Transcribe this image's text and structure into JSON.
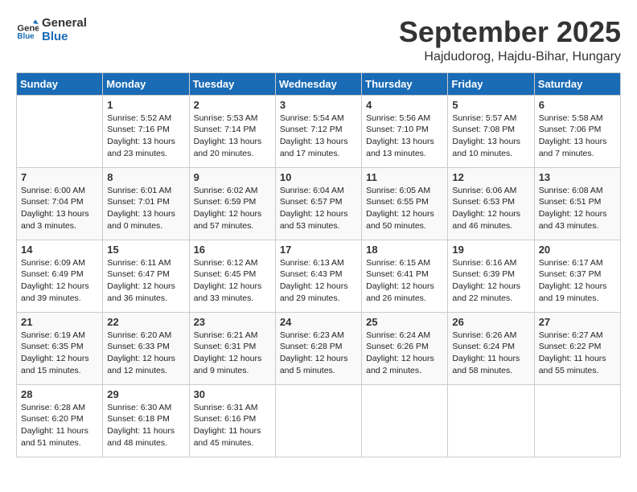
{
  "header": {
    "logo_line1": "General",
    "logo_line2": "Blue",
    "month_title": "September 2025",
    "location": "Hajdudorog, Hajdu-Bihar, Hungary"
  },
  "days_of_week": [
    "Sunday",
    "Monday",
    "Tuesday",
    "Wednesday",
    "Thursday",
    "Friday",
    "Saturday"
  ],
  "weeks": [
    [
      {
        "day": "",
        "info": ""
      },
      {
        "day": "1",
        "info": "Sunrise: 5:52 AM\nSunset: 7:16 PM\nDaylight: 13 hours\nand 23 minutes."
      },
      {
        "day": "2",
        "info": "Sunrise: 5:53 AM\nSunset: 7:14 PM\nDaylight: 13 hours\nand 20 minutes."
      },
      {
        "day": "3",
        "info": "Sunrise: 5:54 AM\nSunset: 7:12 PM\nDaylight: 13 hours\nand 17 minutes."
      },
      {
        "day": "4",
        "info": "Sunrise: 5:56 AM\nSunset: 7:10 PM\nDaylight: 13 hours\nand 13 minutes."
      },
      {
        "day": "5",
        "info": "Sunrise: 5:57 AM\nSunset: 7:08 PM\nDaylight: 13 hours\nand 10 minutes."
      },
      {
        "day": "6",
        "info": "Sunrise: 5:58 AM\nSunset: 7:06 PM\nDaylight: 13 hours\nand 7 minutes."
      }
    ],
    [
      {
        "day": "7",
        "info": "Sunrise: 6:00 AM\nSunset: 7:04 PM\nDaylight: 13 hours\nand 3 minutes."
      },
      {
        "day": "8",
        "info": "Sunrise: 6:01 AM\nSunset: 7:01 PM\nDaylight: 13 hours\nand 0 minutes."
      },
      {
        "day": "9",
        "info": "Sunrise: 6:02 AM\nSunset: 6:59 PM\nDaylight: 12 hours\nand 57 minutes."
      },
      {
        "day": "10",
        "info": "Sunrise: 6:04 AM\nSunset: 6:57 PM\nDaylight: 12 hours\nand 53 minutes."
      },
      {
        "day": "11",
        "info": "Sunrise: 6:05 AM\nSunset: 6:55 PM\nDaylight: 12 hours\nand 50 minutes."
      },
      {
        "day": "12",
        "info": "Sunrise: 6:06 AM\nSunset: 6:53 PM\nDaylight: 12 hours\nand 46 minutes."
      },
      {
        "day": "13",
        "info": "Sunrise: 6:08 AM\nSunset: 6:51 PM\nDaylight: 12 hours\nand 43 minutes."
      }
    ],
    [
      {
        "day": "14",
        "info": "Sunrise: 6:09 AM\nSunset: 6:49 PM\nDaylight: 12 hours\nand 39 minutes."
      },
      {
        "day": "15",
        "info": "Sunrise: 6:11 AM\nSunset: 6:47 PM\nDaylight: 12 hours\nand 36 minutes."
      },
      {
        "day": "16",
        "info": "Sunrise: 6:12 AM\nSunset: 6:45 PM\nDaylight: 12 hours\nand 33 minutes."
      },
      {
        "day": "17",
        "info": "Sunrise: 6:13 AM\nSunset: 6:43 PM\nDaylight: 12 hours\nand 29 minutes."
      },
      {
        "day": "18",
        "info": "Sunrise: 6:15 AM\nSunset: 6:41 PM\nDaylight: 12 hours\nand 26 minutes."
      },
      {
        "day": "19",
        "info": "Sunrise: 6:16 AM\nSunset: 6:39 PM\nDaylight: 12 hours\nand 22 minutes."
      },
      {
        "day": "20",
        "info": "Sunrise: 6:17 AM\nSunset: 6:37 PM\nDaylight: 12 hours\nand 19 minutes."
      }
    ],
    [
      {
        "day": "21",
        "info": "Sunrise: 6:19 AM\nSunset: 6:35 PM\nDaylight: 12 hours\nand 15 minutes."
      },
      {
        "day": "22",
        "info": "Sunrise: 6:20 AM\nSunset: 6:33 PM\nDaylight: 12 hours\nand 12 minutes."
      },
      {
        "day": "23",
        "info": "Sunrise: 6:21 AM\nSunset: 6:31 PM\nDaylight: 12 hours\nand 9 minutes."
      },
      {
        "day": "24",
        "info": "Sunrise: 6:23 AM\nSunset: 6:28 PM\nDaylight: 12 hours\nand 5 minutes."
      },
      {
        "day": "25",
        "info": "Sunrise: 6:24 AM\nSunset: 6:26 PM\nDaylight: 12 hours\nand 2 minutes."
      },
      {
        "day": "26",
        "info": "Sunrise: 6:26 AM\nSunset: 6:24 PM\nDaylight: 11 hours\nand 58 minutes."
      },
      {
        "day": "27",
        "info": "Sunrise: 6:27 AM\nSunset: 6:22 PM\nDaylight: 11 hours\nand 55 minutes."
      }
    ],
    [
      {
        "day": "28",
        "info": "Sunrise: 6:28 AM\nSunset: 6:20 PM\nDaylight: 11 hours\nand 51 minutes."
      },
      {
        "day": "29",
        "info": "Sunrise: 6:30 AM\nSunset: 6:18 PM\nDaylight: 11 hours\nand 48 minutes."
      },
      {
        "day": "30",
        "info": "Sunrise: 6:31 AM\nSunset: 6:16 PM\nDaylight: 11 hours\nand 45 minutes."
      },
      {
        "day": "",
        "info": ""
      },
      {
        "day": "",
        "info": ""
      },
      {
        "day": "",
        "info": ""
      },
      {
        "day": "",
        "info": ""
      }
    ]
  ]
}
